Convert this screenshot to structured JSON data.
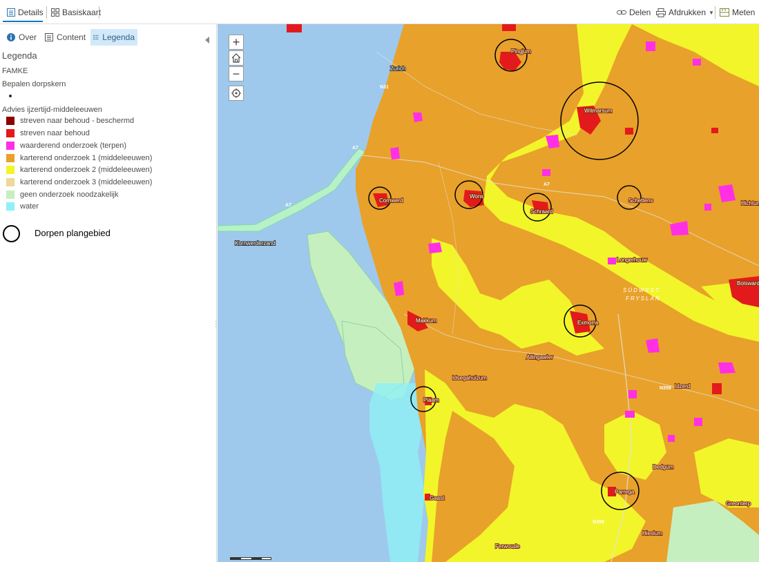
{
  "topbar": {
    "tab_details": "Details",
    "tab_basemap": "Basiskaart",
    "share": "Delen",
    "print": "Afdrukken",
    "measure": "Meten"
  },
  "sidebar": {
    "tabs": [
      {
        "label": "Over",
        "icon": "info-icon"
      },
      {
        "label": "Content",
        "icon": "content-icon"
      },
      {
        "label": "Legenda",
        "icon": "legend-icon"
      }
    ],
    "active_tab": "Legenda",
    "legend_title": "Legenda",
    "layer_name": "FAMKE",
    "sublayer_1": "Bepalen dorpskern",
    "sublayer_2": "Advies ijzertijd-middeleeuwen",
    "items": [
      {
        "label": "streven naar behoud - beschermd",
        "color": "#8b0000"
      },
      {
        "label": "streven naar behoud",
        "color": "#e31a1c"
      },
      {
        "label": "waarderend onderzoek (terpen)",
        "color": "#ff2fe6"
      },
      {
        "label": "karterend onderzoek 1 (middeleeuwen)",
        "color": "#e8a12a"
      },
      {
        "label": "karterend onderzoek 2 (middeleeuwen)",
        "color": "#f2f52a"
      },
      {
        "label": "karterend onderzoek 3 (middeleeuwen)",
        "color": "#f0d79a"
      },
      {
        "label": "geen onderzoek noodzakelijk",
        "color": "#c6efc0"
      },
      {
        "label": "water",
        "color": "#8ff0f5"
      }
    ],
    "circle_legend": "Dorpen plangebied"
  },
  "map": {
    "zoom_in": "+",
    "zoom_out": "−",
    "places": [
      "Pingjum",
      "Zurich",
      "Witmarsum",
      "Cornwerd",
      "Wons",
      "Schraard",
      "Schettens",
      "Hichtum",
      "Kornwerderzand",
      "Longerhouw",
      "Bolsward",
      "Makkum",
      "Exmorra",
      "Allingawier",
      "Idsegahuizum",
      "Piaam",
      "Idzerd",
      "Dedgum",
      "Parrega",
      "Gaast",
      "Greonterp",
      "Hieslum",
      "Ferwoude"
    ],
    "roads": [
      "N31",
      "A7",
      "A7",
      "A7",
      "N359",
      "N359"
    ],
    "region": [
      "SÚDWEST",
      "FRYSLÂN"
    ]
  }
}
